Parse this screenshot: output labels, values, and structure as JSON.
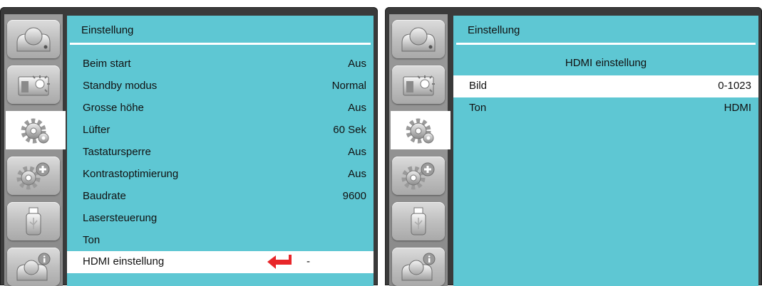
{
  "left_menu": {
    "title": "Einstellung",
    "items": [
      {
        "label": "Beim start",
        "value": "Aus"
      },
      {
        "label": "Standby modus",
        "value": "Normal"
      },
      {
        "label": "Grosse höhe",
        "value": "Aus"
      },
      {
        "label": "Lüfter",
        "value": "60 Sek"
      },
      {
        "label": "Tastatursperre",
        "value": "Aus"
      },
      {
        "label": "Kontrastoptimierung",
        "value": "Aus"
      },
      {
        "label": "Baudrate",
        "value": "9600"
      },
      {
        "label": "Lasersteuerung",
        "value": ""
      },
      {
        "label": "Ton",
        "value": ""
      },
      {
        "label": "HDMI einstellung",
        "value": "-"
      }
    ],
    "selected_index": 9
  },
  "right_menu": {
    "title": "Einstellung",
    "subtitle": "HDMI einstellung",
    "items": [
      {
        "label": "Bild",
        "value": "0-1023"
      },
      {
        "label": "Ton",
        "value": "HDMI"
      }
    ],
    "selected_index": 0
  },
  "sidebar": {
    "icons": [
      "camera-icon",
      "display-brightness-icon",
      "settings-gears-icon",
      "advanced-settings-icon",
      "usb-icon",
      "info-icon"
    ],
    "active_index": 2
  },
  "colors": {
    "panel": "#5ec7d3",
    "selected_row": "#ffffff",
    "enter_arrow": "#e8262a"
  }
}
